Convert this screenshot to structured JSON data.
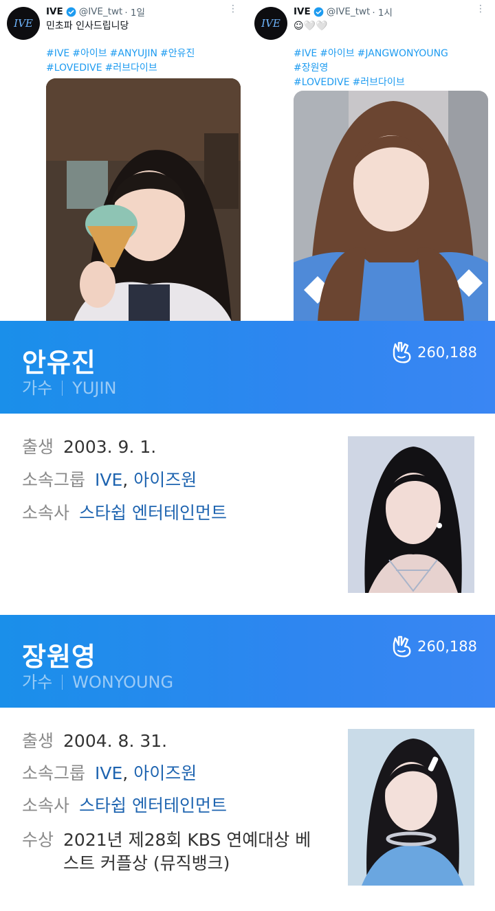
{
  "tweets": [
    {
      "name": "IVE",
      "handle": "@IVE_twt",
      "time": "· 1일",
      "text": "민초파 인사드립니당",
      "hashtags": [
        "#IVE",
        "#아이브",
        "#ANYUJIN",
        "#안유진",
        "#LOVEDIVE",
        "#러브다이브"
      ],
      "photo_icon": "ice-cream-selfie-photo"
    },
    {
      "name": "IVE",
      "handle": "@IVE_twt",
      "time": "· 1시",
      "text": "☺🤍🤍",
      "hashtags": [
        "#IVE",
        "#아이브",
        "#JANGWONYOUNG",
        "#장원영",
        "#LOVEDIVE",
        "#러브다이브"
      ],
      "photo_icon": "selfie-photo"
    }
  ],
  "profiles": [
    {
      "name": "안유진",
      "role": "가수",
      "stage_name": "YUJIN",
      "fans": "260,188",
      "birth_label": "출생",
      "birth": "2003. 9. 1.",
      "group_label": "소속그룹",
      "group_1": "IVE",
      "group_sep": ",",
      "group_2": "아이즈원",
      "agency_label": "소속사",
      "agency": "스타쉽 엔터테인먼트"
    },
    {
      "name": "장원영",
      "role": "가수",
      "stage_name": "WONYOUNG",
      "fans": "260,188",
      "birth_label": "출생",
      "birth": "2004. 8. 31.",
      "group_label": "소속그룹",
      "group_1": "IVE",
      "group_sep": ",",
      "group_2": "아이즈원",
      "agency_label": "소속사",
      "agency": "스타쉽 엔터테인먼트",
      "award_label": "수상",
      "award": "2021년 제28회 KBS 연예대상 베스트 커플상 (뮤직뱅크)"
    }
  ],
  "colors": {
    "band": "#2589ee",
    "link": "#1e64b0",
    "hashtag": "#1d9bf0"
  }
}
